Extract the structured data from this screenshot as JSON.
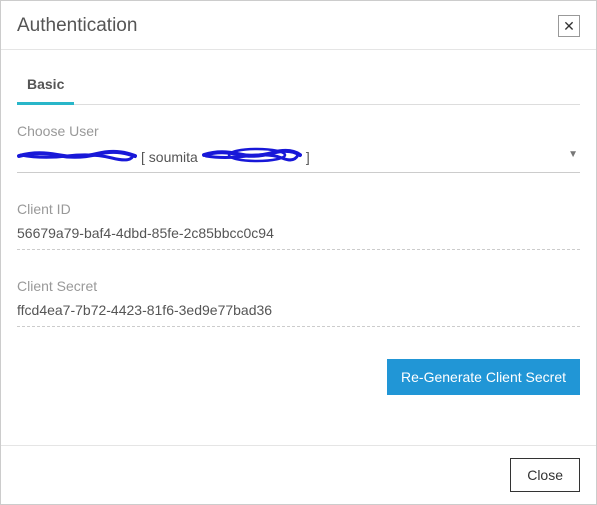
{
  "header": {
    "title": "Authentication"
  },
  "tabs": {
    "basic": "Basic"
  },
  "fields": {
    "choose_user": {
      "label": "Choose User",
      "value_visible_part": "[ soumita",
      "value_closing": "]"
    },
    "client_id": {
      "label": "Client ID",
      "value": "56679a79-baf4-4dbd-85fe-2c85bbcc0c94"
    },
    "client_secret": {
      "label": "Client Secret",
      "value": "ffcd4ea7-7b72-4423-81f6-3ed9e77bad36"
    }
  },
  "buttons": {
    "regenerate": "Re-Generate Client Secret",
    "close": "Close"
  }
}
